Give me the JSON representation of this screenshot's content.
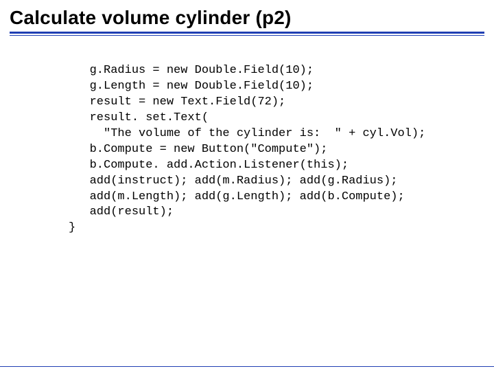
{
  "title": "Calculate volume cylinder (p2)",
  "code": {
    "l1": "   g.Radius = new Double.Field(10);",
    "l2": "   g.Length = new Double.Field(10);",
    "l3": "   result = new Text.Field(72);",
    "l4": "   result. set.Text(",
    "l5": "     \"The volume of the cylinder is:  \" + cyl.Vol);",
    "l6": "   b.Compute = new Button(\"Compute\");",
    "l7": "   b.Compute. add.Action.Listener(this);",
    "l8": "   add(instruct); add(m.Radius); add(g.Radius);",
    "l9": "   add(m.Length); add(g.Length); add(b.Compute);",
    "l10": "   add(result);",
    "l11": "}"
  }
}
